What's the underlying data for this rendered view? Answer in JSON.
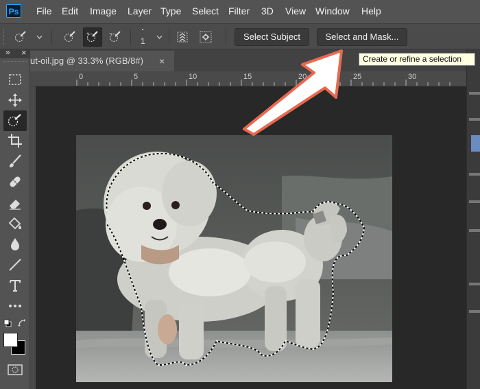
{
  "app": {
    "logo_text": "Ps"
  },
  "menu": [
    "File",
    "Edit",
    "Image",
    "Layer",
    "Type",
    "Select",
    "Filter",
    "3D",
    "View",
    "Window",
    "Help"
  ],
  "options_bar": {
    "brush_size": "1",
    "select_subject_label": "Select Subject",
    "select_and_mask_label": "Select and Mask..."
  },
  "tooltip": {
    "text": "Create or refine a selection"
  },
  "document": {
    "tab_title": "ut-oil.jpg @ 33.3% (RGB/8#)",
    "close_glyph": "×"
  },
  "ruler": {
    "ticks": [
      "0",
      "5",
      "10",
      "15",
      "20",
      "25",
      "30"
    ]
  },
  "toolbar": {
    "collapse_glyph": "»",
    "close_glyph": "×",
    "tools": [
      "rectangular-marquee",
      "move",
      "quick-selection",
      "crop",
      "brush",
      "healing-brush",
      "eraser",
      "paint-bucket",
      "blur",
      "line",
      "type",
      "more"
    ]
  },
  "colors": {
    "accent": "#31a8ff",
    "arrow": "#e8694f",
    "foreground": "#ffffff",
    "background": "#000000"
  }
}
